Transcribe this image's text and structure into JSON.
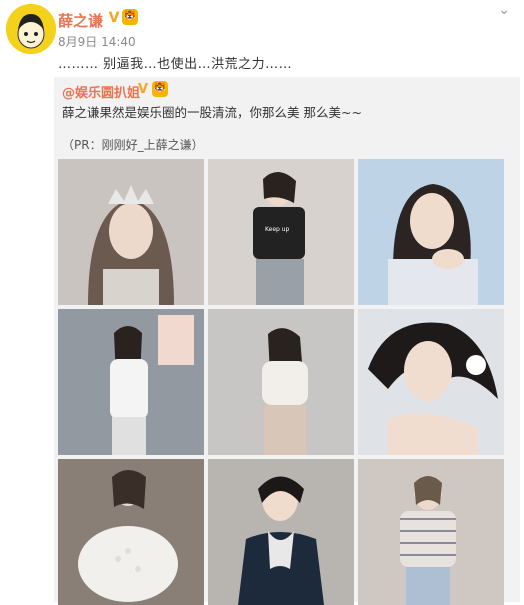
{
  "post": {
    "author": "薛之谦",
    "verified_mark": "V",
    "badge": "🐯",
    "time": "8月9日 14:40",
    "text": "………  别逼我…也使出…洪荒之力……",
    "menu_icon": "chevron-down-icon"
  },
  "repost": {
    "author": "@娱乐圆扒姐",
    "verified_mark": "V",
    "badge": "🐯",
    "text": "薛之谦果然是娱乐圈的一股清流，你那么美 那么美~~",
    "pr_text": "（PR：刚刚好_上薛之谦）"
  },
  "photos": [
    {
      "desc": "photo-1"
    },
    {
      "desc": "photo-2"
    },
    {
      "desc": "photo-3"
    },
    {
      "desc": "photo-4"
    },
    {
      "desc": "photo-5"
    },
    {
      "desc": "photo-6"
    },
    {
      "desc": "photo-7"
    },
    {
      "desc": "photo-8"
    },
    {
      "desc": "photo-9"
    }
  ],
  "colors": {
    "name": "#eb7350",
    "gold": "#f5a623",
    "repost_bg": "#f2f2f2"
  }
}
